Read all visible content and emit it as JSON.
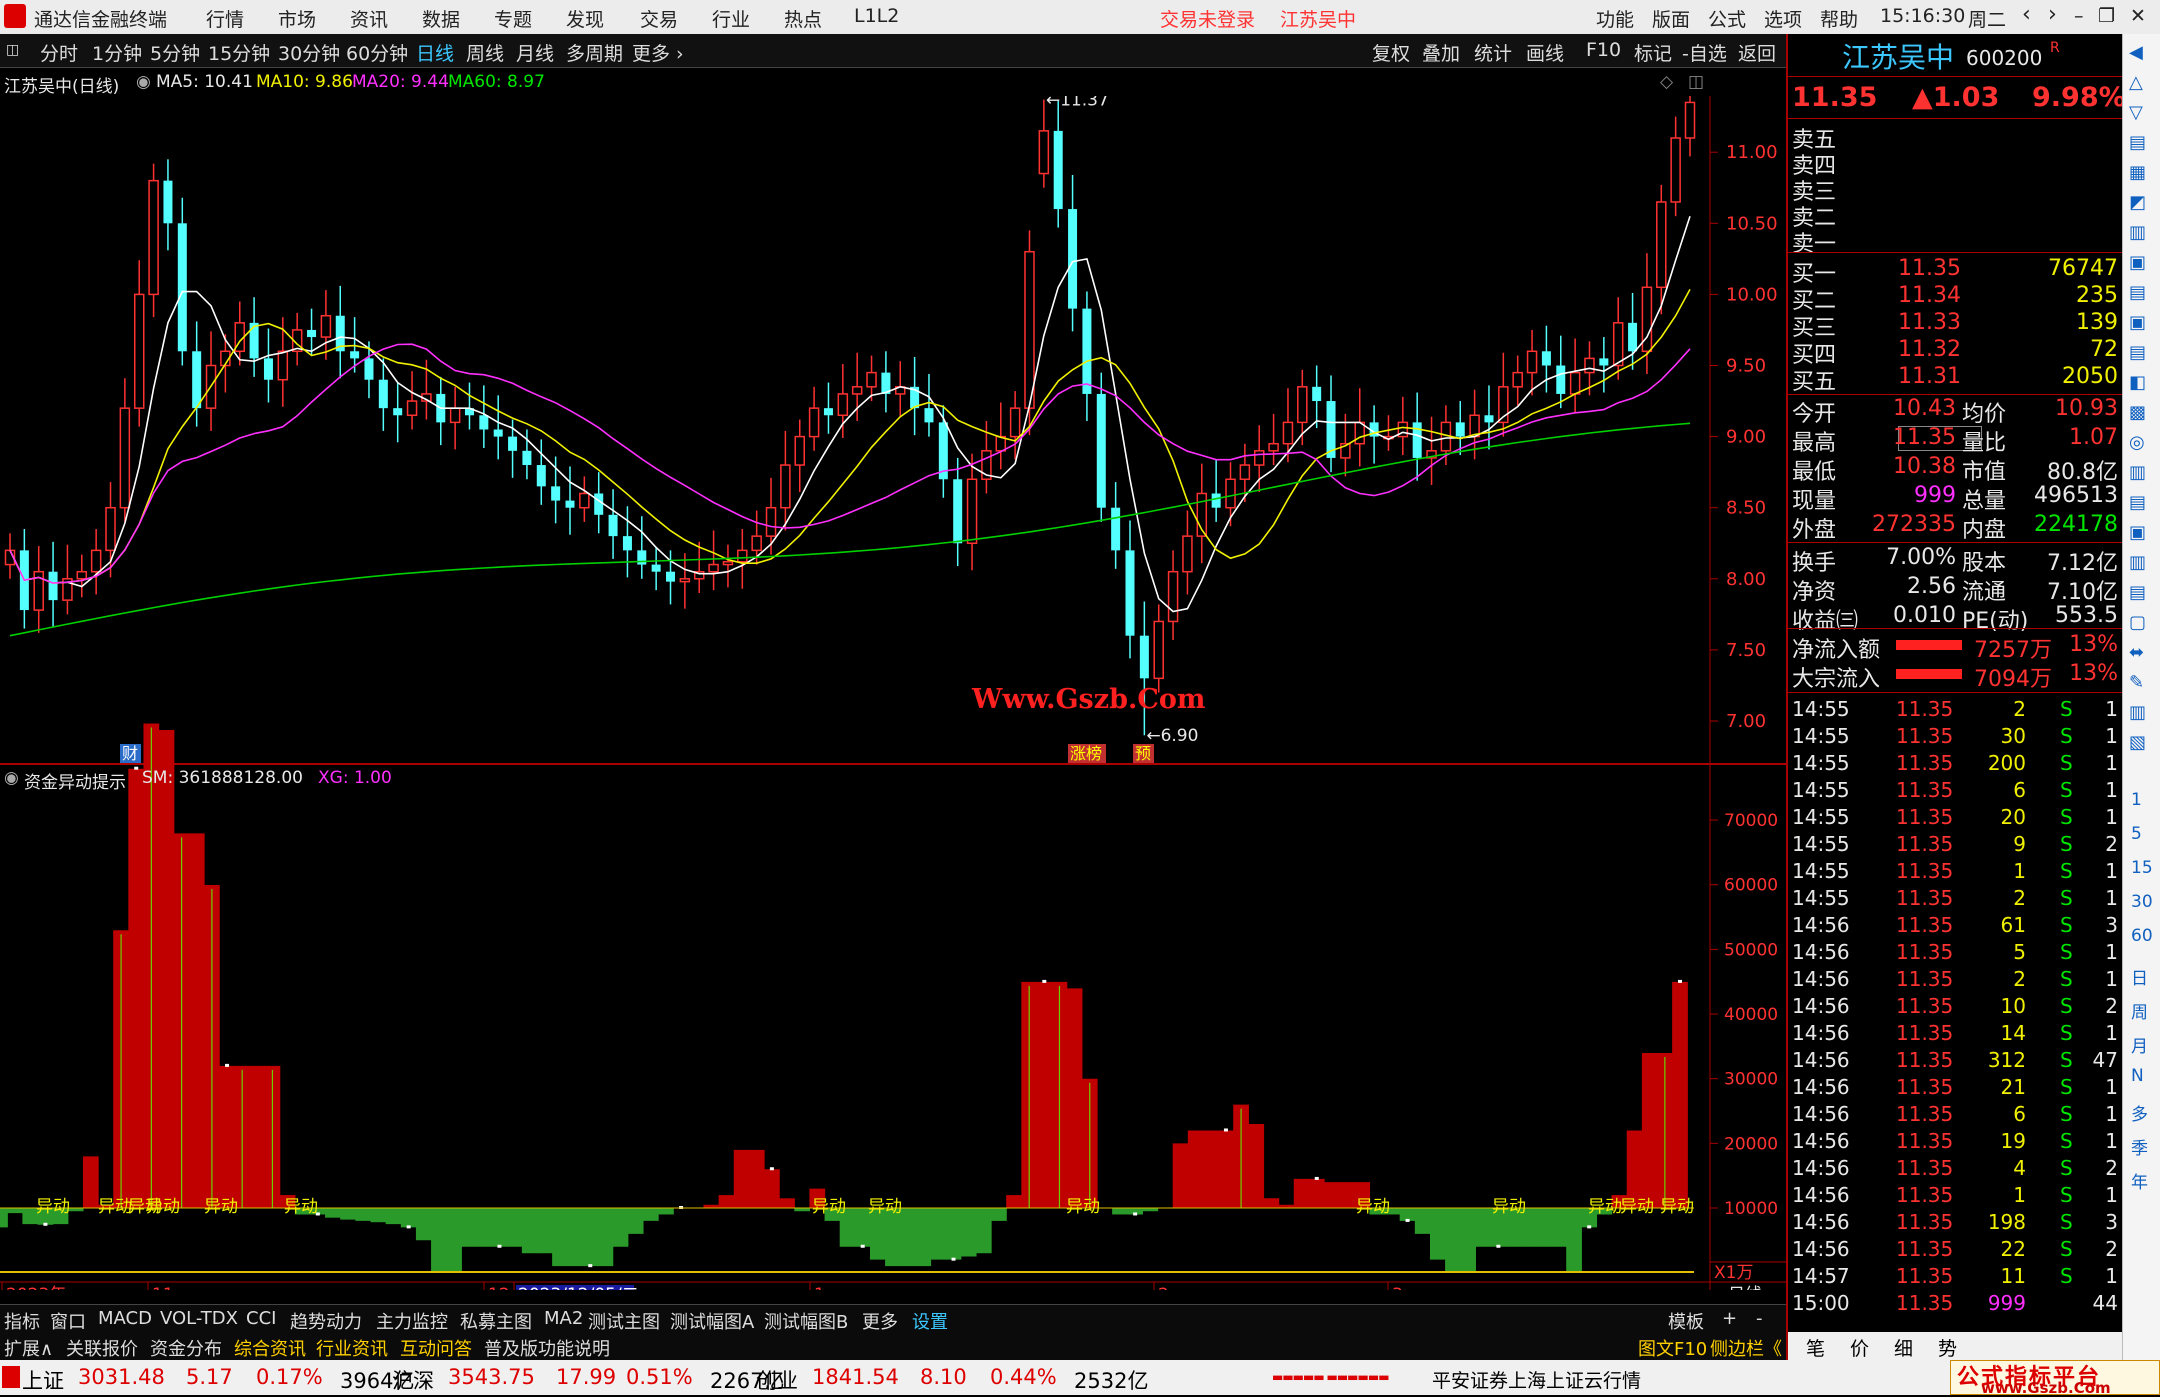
{
  "window": {
    "app_title": "通达信金融终端",
    "menu": [
      "行情",
      "市场",
      "资讯",
      "数据",
      "专题",
      "发现",
      "交易",
      "行业",
      "热点",
      "L1L2"
    ],
    "login_status": "交易未登录",
    "stock_title": "江苏吴中",
    "right_menu": [
      "功能",
      "版面",
      "公式",
      "选项",
      "帮助"
    ],
    "clock": "15:16:30",
    "weekday": "周二"
  },
  "toolbar": {
    "periods": [
      "分时",
      "1分钟",
      "5分钟",
      "15分钟",
      "30分钟",
      "60分钟",
      "日线",
      "周线",
      "月线",
      "多周期",
      "更多"
    ],
    "active": "日线",
    "actions": [
      "复权",
      "叠加",
      "统计",
      "画线",
      "F10",
      "标记",
      "-自选",
      "返回"
    ]
  },
  "main_info": {
    "name": "江苏吴中(日线)",
    "ma5": "MA5: 10.41",
    "ma10": "MA10: 9.86",
    "ma20": "MA20: 9.44",
    "ma60": "MA60: 8.97",
    "high_label": "11.37",
    "low_label": "6.90",
    "watermark": "Www.Gszb.Com",
    "markers": [
      "财",
      "涨榜",
      "预"
    ],
    "axis": [
      "11.00",
      "10.50",
      "10.00",
      "9.50",
      "9.00",
      "8.50",
      "8.00",
      "7.50",
      "7.00"
    ]
  },
  "sub_info": {
    "name": "资金异动提示",
    "sm": "SM: 361888128.00",
    "xg": "XG: 1.00",
    "axis": [
      "70000",
      "60000",
      "50000",
      "40000",
      "30000",
      "20000",
      "10000"
    ],
    "unit": "X1万",
    "signal": "异动"
  },
  "date_axis": {
    "labels": [
      "2023年",
      "11",
      "12",
      "2023/12/05/二",
      "1",
      "2",
      "3"
    ],
    "period_label": "日线"
  },
  "tabs1": [
    "指标",
    "窗口",
    "MACD",
    "VOL-TDX",
    "CCI",
    "趋势动力",
    "主力监控",
    "私募主图",
    "MA2",
    "测试主图",
    "测试幅图A",
    "测试幅图B",
    "更多",
    "设置"
  ],
  "tabs1_right": [
    "模板",
    "+",
    "-"
  ],
  "tabs2": [
    "扩展∧",
    "关联报价",
    "资金分布",
    "综合资讯",
    "行业资讯",
    "互动问答",
    "普及版功能说明"
  ],
  "tabs2_right": [
    "图文F10",
    "侧边栏《"
  ],
  "quote": {
    "name": "江苏吴中",
    "code": "600200",
    "flag": "R",
    "price": "11.35",
    "change": "▲1.03",
    "pct": "9.98%",
    "asks": [
      {
        "label": "卖五",
        "price": "",
        "vol": ""
      },
      {
        "label": "卖四",
        "price": "",
        "vol": ""
      },
      {
        "label": "卖三",
        "price": "",
        "vol": ""
      },
      {
        "label": "卖二",
        "price": "",
        "vol": ""
      },
      {
        "label": "卖一",
        "price": "",
        "vol": ""
      }
    ],
    "bids": [
      {
        "label": "买一",
        "price": "11.35",
        "vol": "76747"
      },
      {
        "label": "买二",
        "price": "11.34",
        "vol": "235"
      },
      {
        "label": "买三",
        "price": "11.33",
        "vol": "139"
      },
      {
        "label": "买四",
        "price": "11.32",
        "vol": "72"
      },
      {
        "label": "买五",
        "price": "11.31",
        "vol": "2050"
      }
    ],
    "stats": [
      {
        "l1": "今开",
        "v1": "10.43",
        "l2": "均价",
        "v2": "10.93"
      },
      {
        "l1": "最高",
        "v1": "11.35",
        "l2": "量比",
        "v2": "1.07"
      },
      {
        "l1": "最低",
        "v1": "10.38",
        "l2": "市值",
        "v2": "80.8亿"
      },
      {
        "l1": "现量",
        "v1": "999",
        "l2": "总量",
        "v2": "496513"
      },
      {
        "l1": "外盘",
        "v1": "272335",
        "l2": "内盘",
        "v2": "224178"
      },
      {
        "l1": "换手",
        "v1": "7.00%",
        "l2": "股本",
        "v2": "7.12亿"
      },
      {
        "l1": "净资",
        "v1": "2.56",
        "l2": "流通",
        "v2": "7.10亿"
      },
      {
        "l1": "收益㈢",
        "v1": "0.010",
        "l2": "PE(动)",
        "v2": "553.5"
      }
    ],
    "flows": [
      {
        "label": "净流入额",
        "val": "7257万",
        "pct": "13%"
      },
      {
        "label": "大宗流入",
        "val": "7094万",
        "pct": "13%"
      }
    ],
    "ticks": [
      [
        "14:55",
        "11.35",
        "2",
        "S",
        "1"
      ],
      [
        "14:55",
        "11.35",
        "30",
        "S",
        "1"
      ],
      [
        "14:55",
        "11.35",
        "200",
        "S",
        "1"
      ],
      [
        "14:55",
        "11.35",
        "6",
        "S",
        "1"
      ],
      [
        "14:55",
        "11.35",
        "20",
        "S",
        "1"
      ],
      [
        "14:55",
        "11.35",
        "9",
        "S",
        "2"
      ],
      [
        "14:55",
        "11.35",
        "1",
        "S",
        "1"
      ],
      [
        "14:55",
        "11.35",
        "2",
        "S",
        "1"
      ],
      [
        "14:56",
        "11.35",
        "61",
        "S",
        "3"
      ],
      [
        "14:56",
        "11.35",
        "5",
        "S",
        "1"
      ],
      [
        "14:56",
        "11.35",
        "2",
        "S",
        "1"
      ],
      [
        "14:56",
        "11.35",
        "10",
        "S",
        "2"
      ],
      [
        "14:56",
        "11.35",
        "14",
        "S",
        "1"
      ],
      [
        "14:56",
        "11.35",
        "312",
        "S",
        "47"
      ],
      [
        "14:56",
        "11.35",
        "21",
        "S",
        "1"
      ],
      [
        "14:56",
        "11.35",
        "6",
        "S",
        "1"
      ],
      [
        "14:56",
        "11.35",
        "19",
        "S",
        "1"
      ],
      [
        "14:56",
        "11.35",
        "4",
        "S",
        "2"
      ],
      [
        "14:56",
        "11.35",
        "1",
        "S",
        "1"
      ],
      [
        "14:56",
        "11.35",
        "198",
        "S",
        "3"
      ],
      [
        "14:56",
        "11.35",
        "22",
        "S",
        "2"
      ],
      [
        "14:57",
        "11.35",
        "11",
        "S",
        "1"
      ],
      [
        "15:00",
        "11.35",
        "999",
        "",
        "44"
      ]
    ],
    "bottom_tabs": [
      "笔",
      "价",
      "细",
      "势"
    ]
  },
  "sidebar": [
    "1",
    "5",
    "15",
    "30",
    "60",
    "日",
    "周",
    "月",
    "N",
    "多",
    "季",
    "年"
  ],
  "statusbar": {
    "items": [
      {
        "name": "上证",
        "v": "3031.48",
        "c": "5.17",
        "p": "0.17%",
        "a": "3964亿"
      },
      {
        "name": "沪深",
        "v": "3543.75",
        "c": "17.99",
        "p": "0.51%",
        "a": "2267亿"
      },
      {
        "name": "创业",
        "v": "1841.54",
        "c": "8.10",
        "p": "0.44%",
        "a": "2532亿"
      }
    ],
    "broker": "平安证券上海上证云行情",
    "logo": "公式指标平台",
    "logo_url": "www.Gszb.Com"
  },
  "colors": {
    "up": "#ff3232",
    "down": "#54ffff",
    "ma5": "#ffffff",
    "ma10": "#f0f000",
    "ma20": "#ff30ff",
    "ma60": "#00d000",
    "bar_red": "#c00000",
    "bar_green": "#2a9a2a"
  },
  "chart_data": [
    {
      "type": "candlestick",
      "title": "江苏吴中(日线)",
      "ylim": [
        6.9,
        11.37
      ],
      "high": 11.37,
      "low": 6.9,
      "last_close": 11.35,
      "series": [
        {
          "name": "MA5",
          "values": [
            10.41
          ]
        },
        {
          "name": "MA10",
          "values": [
            9.86
          ]
        },
        {
          "name": "MA20",
          "values": [
            9.44
          ]
        },
        {
          "name": "MA60",
          "values": [
            8.97
          ]
        }
      ]
    },
    {
      "type": "area",
      "title": "资金异动提示",
      "ylim": [
        0,
        75000
      ],
      "series": [
        {
          "name": "SM",
          "values": [
            361888128.0
          ]
        },
        {
          "name": "XG",
          "values": [
            1.0
          ]
        }
      ]
    }
  ]
}
